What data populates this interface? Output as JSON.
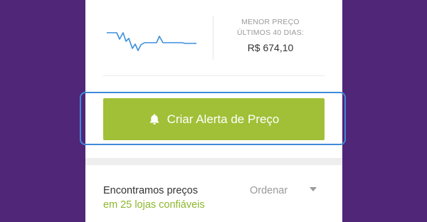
{
  "price_history": {
    "label_line1": "MENOR PREÇO",
    "label_line2": "ÚLTIMOS 40 DIAS:",
    "min_price": "R$ 674,10",
    "sparkline_color": "#3d8fdc",
    "sparkline_icon": "price-trend-sparkline"
  },
  "alert": {
    "label": "Criar Alerta de Preço",
    "icon": "bell-icon",
    "color": "#a1c037"
  },
  "results": {
    "title": "Encontramos preços",
    "subtitle": "em 25 lojas confiáveis",
    "subtitle_color": "#8cb72e"
  },
  "sort": {
    "label": "Ordenar",
    "icon": "caret-down-icon"
  },
  "colors": {
    "background": "#502678",
    "card": "#ffffff",
    "focus_ring": "#3f8ad8"
  }
}
